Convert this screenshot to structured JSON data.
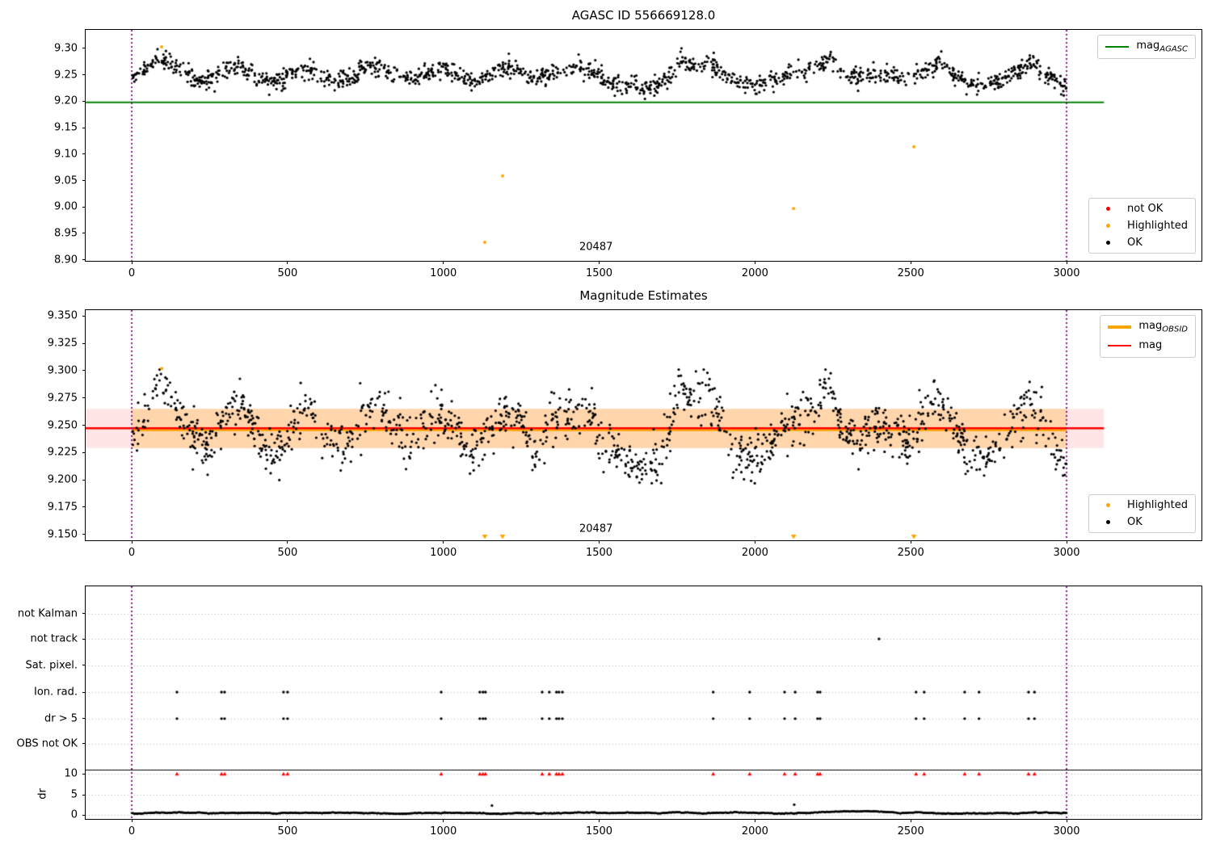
{
  "colors": {
    "green": "#008000",
    "red": "#ff0000",
    "orange": "#ffa500",
    "purple": "#800080",
    "black": "#000000",
    "grid": "#b0b0b0",
    "band_red": "rgba(255,0,0,0.10)",
    "band_orange": "rgba(255,165,0,0.25)"
  },
  "chart_data": [
    {
      "id": "top",
      "type": "scatter",
      "title": "AGASC ID 556669128.0",
      "xlim": [
        -148,
        3433
      ],
      "ylim": [
        8.898,
        9.335
      ],
      "xtick_values": [
        0,
        500,
        1000,
        1500,
        2000,
        2500,
        3000
      ],
      "xtick_labels": [
        "0",
        "500",
        "1000",
        "1500",
        "2000",
        "2500",
        "3000"
      ],
      "ytick_values": [
        9.3,
        9.25,
        9.2,
        9.15,
        9.1,
        9.05,
        9.0,
        8.95,
        8.9
      ],
      "ytick_labels": [
        "9.30",
        "9.25",
        "9.20",
        "9.15",
        "9.10",
        "9.05",
        "9.00",
        "8.95",
        "8.90"
      ],
      "vlines": {
        "x": [
          0,
          3000
        ],
        "color_key": "purple"
      },
      "hline": {
        "value": 9.198,
        "x0": -148,
        "x1": 3120,
        "color_key": "green",
        "lw": 2
      },
      "scatter": {
        "seed": 20487,
        "count": 1400,
        "x0": 0,
        "x1": 3000,
        "sd": 0.0085,
        "ymin": 9.204,
        "ymax": 9.312,
        "mean_keypoints": [
          [
            0,
            9.238
          ],
          [
            40,
            9.258
          ],
          [
            90,
            9.282
          ],
          [
            140,
            9.266
          ],
          [
            185,
            9.247
          ],
          [
            235,
            9.237
          ],
          [
            285,
            9.255
          ],
          [
            330,
            9.268
          ],
          [
            375,
            9.258
          ],
          [
            425,
            9.24
          ],
          [
            470,
            9.232
          ],
          [
            520,
            9.256
          ],
          [
            565,
            9.266
          ],
          [
            615,
            9.244
          ],
          [
            665,
            9.238
          ],
          [
            705,
            9.243
          ],
          [
            745,
            9.262
          ],
          [
            790,
            9.267
          ],
          [
            845,
            9.251
          ],
          [
            895,
            9.24
          ],
          [
            945,
            9.253
          ],
          [
            995,
            9.261
          ],
          [
            1045,
            9.249
          ],
          [
            1095,
            9.236
          ],
          [
            1145,
            9.249
          ],
          [
            1195,
            9.262
          ],
          [
            1245,
            9.26
          ],
          [
            1295,
            9.236
          ],
          [
            1345,
            9.252
          ],
          [
            1395,
            9.259
          ],
          [
            1445,
            9.267
          ],
          [
            1495,
            9.251
          ],
          [
            1545,
            9.238
          ],
          [
            1595,
            9.228
          ],
          [
            1645,
            9.225
          ],
          [
            1695,
            9.233
          ],
          [
            1740,
            9.258
          ],
          [
            1760,
            9.278
          ],
          [
            1800,
            9.266
          ],
          [
            1845,
            9.272
          ],
          [
            1895,
            9.258
          ],
          [
            1945,
            9.233
          ],
          [
            1995,
            9.228
          ],
          [
            2045,
            9.241
          ],
          [
            2095,
            9.251
          ],
          [
            2145,
            9.257
          ],
          [
            2195,
            9.267
          ],
          [
            2240,
            9.276
          ],
          [
            2290,
            9.247
          ],
          [
            2340,
            9.246
          ],
          [
            2390,
            9.251
          ],
          [
            2440,
            9.251
          ],
          [
            2490,
            9.241
          ],
          [
            2540,
            9.257
          ],
          [
            2590,
            9.271
          ],
          [
            2640,
            9.251
          ],
          [
            2690,
            9.233
          ],
          [
            2740,
            9.229
          ],
          [
            2790,
            9.241
          ],
          [
            2840,
            9.257
          ],
          [
            2890,
            9.271
          ],
          [
            2940,
            9.247
          ],
          [
            3000,
            9.226
          ]
        ]
      },
      "highlighted_points": [
        [
          96,
          9.303
        ],
        [
          1133,
          8.933
        ],
        [
          1190,
          9.059
        ],
        [
          2124,
          8.997
        ],
        [
          2510,
          9.114
        ]
      ],
      "annotation": {
        "text": "20487",
        "x": 1490,
        "y": 8.924
      },
      "legend_top": {
        "items": [
          {
            "type": "line",
            "color_key": "green",
            "lw": 2,
            "main": "mag",
            "sub": "AGASC"
          }
        ]
      },
      "legend_bottom": {
        "items": [
          {
            "type": "dot",
            "color_key": "red",
            "label": "not OK"
          },
          {
            "type": "dot",
            "color_key": "orange",
            "label": "Highlighted"
          },
          {
            "type": "dot",
            "color_key": "black",
            "label": "OK"
          }
        ]
      }
    },
    {
      "id": "middle",
      "type": "scatter",
      "title": "Magnitude Estimates",
      "xlim": [
        -148,
        3433
      ],
      "ylim": [
        9.1445,
        9.3555
      ],
      "xtick_values": [
        0,
        500,
        1000,
        1500,
        2000,
        2500,
        3000
      ],
      "xtick_labels": [
        "0",
        "500",
        "1000",
        "1500",
        "2000",
        "2500",
        "3000"
      ],
      "ytick_values": [
        9.35,
        9.325,
        9.3,
        9.275,
        9.25,
        9.225,
        9.2,
        9.175,
        9.15
      ],
      "ytick_labels": [
        "9.350",
        "9.325",
        "9.300",
        "9.275",
        "9.250",
        "9.225",
        "9.200",
        "9.175",
        "9.150"
      ],
      "vlines": {
        "x": [
          0,
          3000
        ],
        "color_key": "purple"
      },
      "band_red": {
        "lo": 9.229,
        "hi": 9.265,
        "x0": -148,
        "x1": 3120,
        "color_key": "band_red"
      },
      "band_orange": {
        "lo": 9.229,
        "hi": 9.265,
        "x0": 0,
        "x1": 3000,
        "color_key": "band_orange"
      },
      "line_orange": {
        "value": 9.2455,
        "x0": 0,
        "x1": 3000,
        "color_key": "orange",
        "lw": 2.5
      },
      "line_red": {
        "value": 9.2473,
        "x0": -148,
        "x1": 3120,
        "color_key": "red",
        "lw": 2.5
      },
      "derive": {
        "base": 9.2465,
        "ref": 9.2505,
        "scale": 1.45,
        "sd": 0.011,
        "ymin": 9.193,
        "ymax": 9.301,
        "seed": 556,
        "count": 1350
      },
      "highlighted_points": [
        [
          96,
          9.302
        ]
      ],
      "clip_triangles_x": [
        1133,
        1190,
        2124,
        2510
      ],
      "annotation": {
        "text": "20487",
        "x": 1490,
        "y": 9.155
      },
      "legend_top": {
        "items": [
          {
            "type": "line",
            "color_key": "orange",
            "lw": 3.5,
            "main": "mag",
            "sub": "OBSID"
          },
          {
            "type": "line",
            "color_key": "red",
            "lw": 2,
            "main": "mag",
            "sub": ""
          }
        ]
      },
      "legend_bottom": {
        "items": [
          {
            "type": "dot",
            "color_key": "orange",
            "label": "Highlighted"
          },
          {
            "type": "dot",
            "color_key": "black",
            "label": "OK"
          }
        ]
      }
    },
    {
      "id": "flags",
      "type": "scatter",
      "title": "",
      "xlim": [
        -148,
        3433
      ],
      "xtick_values": [
        0,
        500,
        1000,
        1500,
        2000,
        2500,
        3000
      ],
      "xtick_labels": [
        "0",
        "500",
        "1000",
        "1500",
        "2000",
        "2500",
        "3000"
      ],
      "rows": [
        {
          "label": "not Kalman",
          "frac": 0.118
        },
        {
          "label": "not track",
          "frac": 0.226
        },
        {
          "label": "Sat. pixel.",
          "frac": 0.34
        },
        {
          "label": "Ion. rad.",
          "frac": 0.455
        },
        {
          "label": "dr > 5",
          "frac": 0.569
        },
        {
          "label": "OBS not OK",
          "frac": 0.677
        }
      ],
      "dr_ticks": [
        {
          "label": "10",
          "frac": 0.806
        },
        {
          "label": "5",
          "frac": 0.896
        },
        {
          "label": "0",
          "frac": 0.983
        }
      ],
      "axis_label": "dr",
      "separator_frac": 0.788,
      "vlines": {
        "x": [
          0,
          3000
        ],
        "color_key": "purple"
      },
      "flag_x": [
        145,
        288,
        298,
        487,
        500,
        993,
        1117,
        1127,
        1135,
        1317,
        1340,
        1363,
        1371,
        1382,
        1866,
        1983,
        2095,
        2129,
        2201,
        2209,
        2517,
        2543,
        2673,
        2719,
        2878,
        2897
      ],
      "flag_row_fracs": [
        0.455,
        0.569
      ],
      "extra_points": [
        {
          "row_frac": 0.226,
          "x": [
            2398
          ]
        }
      ],
      "red_caps": {
        "frac": 0.806,
        "color_key": "red"
      },
      "dr_scale": {
        "frac0": 0.983,
        "frac_per_unit": 0.0177
      },
      "dr_outliers": [
        [
          1156,
          2.3
        ],
        [
          2126,
          2.5
        ]
      ],
      "dr_curve": {
        "seed": 99,
        "x0": 0,
        "x1": 3000,
        "step": 2,
        "base": 0.45,
        "jitter": 0.06,
        "hump_x": 2320,
        "hump_w": 110,
        "hump_h": 0.55
      }
    }
  ]
}
